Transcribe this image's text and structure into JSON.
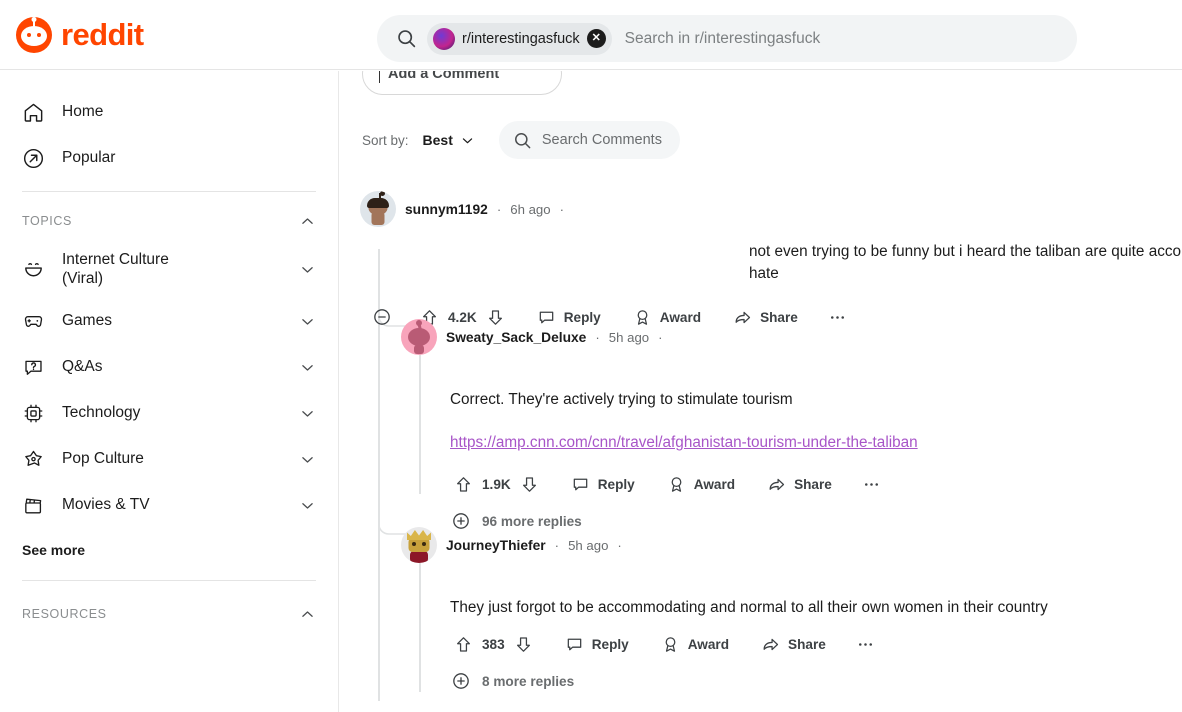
{
  "header": {
    "logo_text": "reddit",
    "logo_icon": "reddit-snoo-logo",
    "search": {
      "icon": "search-icon",
      "chip_label": "r/interestingasfuck",
      "chip_clear_icon": "close-icon",
      "chip_avatar_icon": "subreddit-avatar-icon",
      "placeholder": "Search in r/interestingasfuck",
      "value": ""
    }
  },
  "sidebar": {
    "primary": [
      {
        "label": "Home",
        "icon": "home-icon"
      },
      {
        "label": "Popular",
        "icon": "arrow-up-right-circle-icon"
      }
    ],
    "topics_section": {
      "title": "TOPICS",
      "collapse_icon": "chevron-up-icon",
      "items": [
        {
          "label": "Internet Culture (Viral)",
          "icon": "smiley-icon",
          "chevron": "chevron-down-icon"
        },
        {
          "label": "Games",
          "icon": "gamepad-icon",
          "chevron": "chevron-down-icon"
        },
        {
          "label": "Q&As",
          "icon": "question-bubble-icon",
          "chevron": "chevron-down-icon"
        },
        {
          "label": "Technology",
          "icon": "chip-icon",
          "chevron": "chevron-down-icon"
        },
        {
          "label": "Pop Culture",
          "icon": "star-icon",
          "chevron": "chevron-down-icon"
        },
        {
          "label": "Movies & TV",
          "icon": "clapperboard-icon",
          "chevron": "chevron-down-icon"
        }
      ],
      "see_more": "See more"
    },
    "resources_section": {
      "title": "RESOURCES",
      "collapse_icon": "chevron-up-icon"
    }
  },
  "main": {
    "add_comment_label": "Add a Comment",
    "sort": {
      "label": "Sort by:",
      "value": "Best",
      "chevron": "chevron-down-icon"
    },
    "comment_search": {
      "icon": "search-icon",
      "placeholder": "Search Comments"
    },
    "comments": [
      {
        "id": "c1",
        "author": "sunnym1192",
        "avatar_icon": "avatar-sunny",
        "time": "6h ago",
        "sep_left": "·",
        "sep_right": "·",
        "body": "not even trying to be funny but i heard the taliban are quite accommodating if you're not from a country they hate",
        "collapse_icon": "minus-circle-icon",
        "score": "4.2K",
        "upvote_icon": "upvote-icon",
        "downvote_icon": "downvote-icon",
        "reply_label": "Reply",
        "reply_icon": "comment-bubble-icon",
        "award_label": "Award",
        "award_icon": "award-icon",
        "share_label": "Share",
        "share_icon": "share-arrow-icon",
        "overflow_icon": "ellipsis-icon"
      },
      {
        "id": "c2",
        "author": "Sweaty_Sack_Deluxe",
        "avatar_icon": "avatar-sweaty",
        "time": "5h ago",
        "sep_left": "·",
        "sep_right": "·",
        "body": "Correct. They're actively trying to stimulate tourism",
        "link": "https://amp.cnn.com/cnn/travel/afghanistan-tourism-under-the-taliban",
        "score": "1.9K",
        "upvote_icon": "upvote-icon",
        "downvote_icon": "downvote-icon",
        "reply_label": "Reply",
        "reply_icon": "comment-bubble-icon",
        "award_label": "Award",
        "award_icon": "award-icon",
        "share_label": "Share",
        "share_icon": "share-arrow-icon",
        "overflow_icon": "ellipsis-icon",
        "more_replies": "96 more replies",
        "more_replies_icon": "plus-circle-icon"
      },
      {
        "id": "c3",
        "author": "JourneyThiefer",
        "avatar_icon": "avatar-journey",
        "time": "5h ago",
        "sep_left": "·",
        "sep_right": "·",
        "body": "They just forgot to be accommodating and normal to all their own women in their country",
        "score": "383",
        "upvote_icon": "upvote-icon",
        "downvote_icon": "downvote-icon",
        "reply_label": "Reply",
        "reply_icon": "comment-bubble-icon",
        "award_label": "Award",
        "award_icon": "award-icon",
        "share_label": "Share",
        "share_icon": "share-arrow-icon",
        "overflow_icon": "ellipsis-icon",
        "more_replies": "8 more replies",
        "more_replies_icon": "plus-circle-icon"
      }
    ]
  },
  "colors": {
    "brand_orange": "#ff4500",
    "link_purple": "#a855c8",
    "text": "#1c1c1c",
    "muted": "#6a6d6f",
    "search_bg": "#f2f4f5",
    "thread_line": "#e0e2e3"
  }
}
